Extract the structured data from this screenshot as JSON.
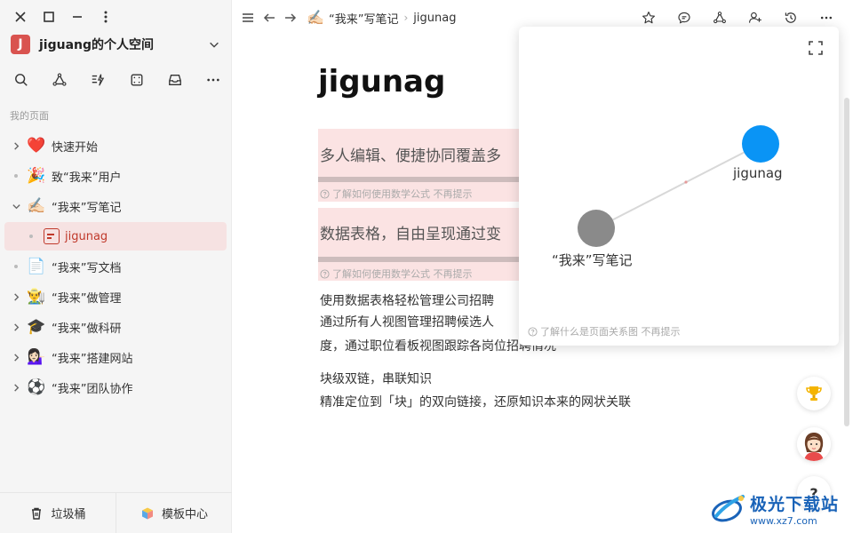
{
  "sidebar": {
    "workspace": {
      "avatar_letter": "J",
      "name": "jiguang的个人空间"
    },
    "section_label": "我的页面",
    "items": [
      {
        "emoji": "❤️",
        "label": "快速开始",
        "toggle": "expand"
      },
      {
        "emoji": "🎉",
        "label": "致“我来”用户",
        "toggle": "dot"
      },
      {
        "emoji": "✍🏻",
        "label": "“我来”写笔记",
        "toggle": "collapse"
      },
      {
        "emoji": "",
        "label": "jigunag",
        "toggle": "dot",
        "child": true,
        "selected": true
      },
      {
        "emoji": "📄",
        "label": "“我来”写文档",
        "toggle": "dot"
      },
      {
        "emoji": "👨‍🌾",
        "label": "“我来”做管理",
        "toggle": "expand"
      },
      {
        "emoji": "🎓",
        "label": "“我来”做科研",
        "toggle": "expand"
      },
      {
        "emoji": "💁🏻‍♀️",
        "label": "“我来”搭建网站",
        "toggle": "expand"
      },
      {
        "emoji": "⚽",
        "label": "“我来”团队协作",
        "toggle": "expand"
      }
    ],
    "footer": {
      "trash_label": "垃圾桶",
      "templates_label": "模板中心"
    }
  },
  "topbar": {
    "breadcrumb": [
      {
        "emoji": "✍🏻",
        "label": "“我来”写笔记"
      },
      {
        "emoji": "",
        "label": "jigunag"
      }
    ]
  },
  "page": {
    "title": "jigunag",
    "blocks": [
      {
        "text": "多人编辑、便捷协同覆盖多",
        "hint": "了解如何使用数学公式 不再提示"
      },
      {
        "text": "数据表格，自由呈现通过变",
        "hint": "了解如何使用数学公式 不再提示"
      }
    ],
    "paragraph1": [
      "使用数据表格轻松管理公司招聘",
      "通过所有人视图管理招聘候选人",
      "度，通过职位看板视图跟踪各岗位招聘情况"
    ],
    "paragraph2": [
      "块级双链，串联知识",
      "精准定位到「块」的双向链接，还原知识本来的网状关联"
    ]
  },
  "graph": {
    "nodes": [
      {
        "label": "jigunag",
        "color": "#0a94f5"
      },
      {
        "label": "“我来”写笔记",
        "color": "#8a8a8a"
      }
    ],
    "hint": "了解什么是页面关系图 不再提示"
  },
  "floating": {
    "help_label": "?"
  },
  "watermark": {
    "title": "极光下载站",
    "url": "www.xz7.com"
  },
  "colors": {
    "accent": "#c0392b",
    "selected_bg": "#f6e2e2",
    "node_blue": "#0a94f5",
    "node_gray": "#8a8a8a"
  }
}
